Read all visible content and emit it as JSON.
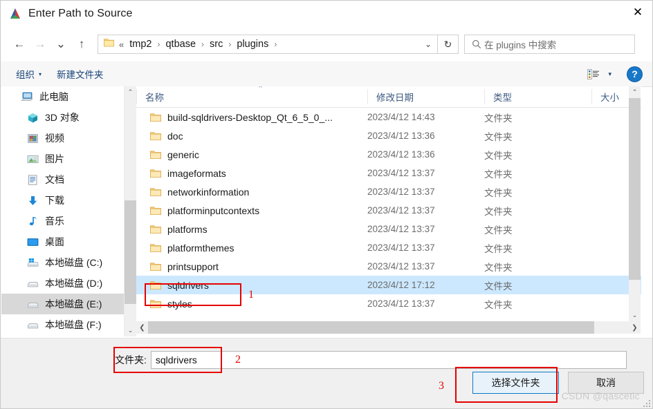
{
  "window": {
    "title": "Enter Path to Source",
    "icon": "qt-creator-icon",
    "close_label": "✕"
  },
  "nav": {
    "back": "←",
    "forward": "→",
    "recent": "⌄",
    "up": "↑",
    "refresh": "↻",
    "dropdown": "⌄",
    "breadcrumb_prefix": "«",
    "breadcrumb": [
      "tmp2",
      "qtbase",
      "src",
      "plugins"
    ],
    "separator": "›"
  },
  "search": {
    "placeholder": "在 plugins 中搜索",
    "icon": "search-icon"
  },
  "commandbar": {
    "organize": "组织",
    "organize_caret": "▾",
    "new_folder": "新建文件夹",
    "view_caret": "▾",
    "help": "?"
  },
  "sidebar": {
    "items": [
      {
        "label": "此电脑",
        "icon": "this-pc-icon",
        "indent": false,
        "selected": false
      },
      {
        "label": "3D 对象",
        "icon": "3d-objects-icon",
        "indent": true,
        "selected": false
      },
      {
        "label": "视频",
        "icon": "videos-icon",
        "indent": true,
        "selected": false
      },
      {
        "label": "图片",
        "icon": "pictures-icon",
        "indent": true,
        "selected": false
      },
      {
        "label": "文档",
        "icon": "documents-icon",
        "indent": true,
        "selected": false
      },
      {
        "label": "下载",
        "icon": "downloads-icon",
        "indent": true,
        "selected": false
      },
      {
        "label": "音乐",
        "icon": "music-icon",
        "indent": true,
        "selected": false
      },
      {
        "label": "桌面",
        "icon": "desktop-icon",
        "indent": true,
        "selected": false
      },
      {
        "label": "本地磁盘 (C:)",
        "icon": "windows-drive-icon",
        "indent": true,
        "selected": false
      },
      {
        "label": "本地磁盘 (D:)",
        "icon": "drive-icon",
        "indent": true,
        "selected": false
      },
      {
        "label": "本地磁盘 (E:)",
        "icon": "drive-icon",
        "indent": true,
        "selected": true
      },
      {
        "label": "本地磁盘 (F:)",
        "icon": "drive-icon",
        "indent": true,
        "selected": false
      }
    ],
    "scroll_up": "⌃",
    "scroll_down": "⌄"
  },
  "filelist": {
    "columns": [
      "名称",
      "修改日期",
      "类型",
      "大小"
    ],
    "sort_indicator": "⌃",
    "rows": [
      {
        "name": "build-sqldrivers-Desktop_Qt_6_5_0_...",
        "date": "2023/4/12 14:43",
        "type": "文件夹",
        "size": "",
        "selected": false
      },
      {
        "name": "doc",
        "date": "2023/4/12 13:36",
        "type": "文件夹",
        "size": "",
        "selected": false
      },
      {
        "name": "generic",
        "date": "2023/4/12 13:36",
        "type": "文件夹",
        "size": "",
        "selected": false
      },
      {
        "name": "imageformats",
        "date": "2023/4/12 13:37",
        "type": "文件夹",
        "size": "",
        "selected": false
      },
      {
        "name": "networkinformation",
        "date": "2023/4/12 13:37",
        "type": "文件夹",
        "size": "",
        "selected": false
      },
      {
        "name": "platforminputcontexts",
        "date": "2023/4/12 13:37",
        "type": "文件夹",
        "size": "",
        "selected": false
      },
      {
        "name": "platforms",
        "date": "2023/4/12 13:37",
        "type": "文件夹",
        "size": "",
        "selected": false
      },
      {
        "name": "platformthemes",
        "date": "2023/4/12 13:37",
        "type": "文件夹",
        "size": "",
        "selected": false
      },
      {
        "name": "printsupport",
        "date": "2023/4/12 13:37",
        "type": "文件夹",
        "size": "",
        "selected": false
      },
      {
        "name": "sqldrivers",
        "date": "2023/4/12 17:12",
        "type": "文件夹",
        "size": "",
        "selected": true
      },
      {
        "name": "styles",
        "date": "2023/4/12 13:37",
        "type": "文件夹",
        "size": "",
        "selected": false
      }
    ],
    "hscroll_left": "❮",
    "hscroll_right": "❯",
    "vscroll_up": "⌃",
    "vscroll_down": "⌄"
  },
  "bottom": {
    "folder_label": "文件夹:",
    "folder_value": "sqldrivers",
    "select_button": "选择文件夹",
    "cancel_button": "取消"
  },
  "annotations": [
    {
      "num": "1"
    },
    {
      "num": "2"
    },
    {
      "num": "3"
    }
  ],
  "watermark": "CSDN @qascetic",
  "colors": {
    "selection": "#cce8ff",
    "annotation": "#e60000",
    "primary_border": "#0d7ac4",
    "link": "#18457a"
  }
}
